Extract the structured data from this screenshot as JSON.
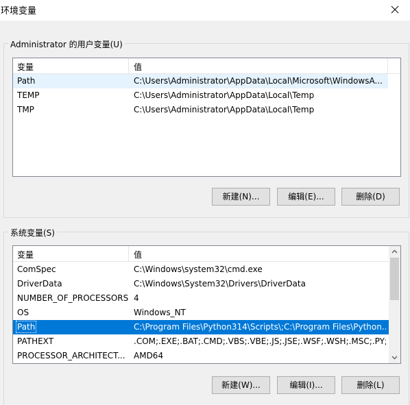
{
  "window": {
    "title": "环境变量"
  },
  "user_group": {
    "label": "Administrator 的用户变量(U)",
    "columns": [
      "变量",
      "值"
    ],
    "rows": [
      {
        "name": "Path",
        "value": "C:\\Users\\Administrator\\AppData\\Local\\Microsoft\\WindowsA..."
      },
      {
        "name": "TEMP",
        "value": "C:\\Users\\Administrator\\AppData\\Local\\Temp"
      },
      {
        "name": "TMP",
        "value": "C:\\Users\\Administrator\\AppData\\Local\\Temp"
      }
    ],
    "buttons": {
      "new": "新建(N)...",
      "edit": "编辑(E)...",
      "delete": "删除(D)"
    }
  },
  "system_group": {
    "label": "系统变量(S)",
    "columns": [
      "变量",
      "值"
    ],
    "rows": [
      {
        "name": "ComSpec",
        "value": "C:\\Windows\\system32\\cmd.exe"
      },
      {
        "name": "DriverData",
        "value": "C:\\Windows\\System32\\Drivers\\DriverData"
      },
      {
        "name": "NUMBER_OF_PROCESSORS",
        "value": "4"
      },
      {
        "name": "OS",
        "value": "Windows_NT"
      },
      {
        "name": "Path",
        "value": "C:\\Program Files\\Python314\\Scripts\\;C:\\Program Files\\Python..."
      },
      {
        "name": "PATHEXT",
        "value": ".COM;.EXE;.BAT;.CMD;.VBS;.VBE;.JS;.JSE;.WSF;.WSH;.MSC;.PY;.P..."
      },
      {
        "name": "PROCESSOR_ARCHITECT...",
        "value": "AMD64"
      }
    ],
    "buttons": {
      "new": "新建(W)...",
      "edit": "编辑(I)...",
      "delete": "删除(L)"
    }
  },
  "colors": {
    "selection": "#0078d7",
    "hover": "#e5f3ff",
    "button_bg": "#e1e1e1"
  },
  "icons": {
    "close": "close-icon",
    "scroll_up": "chevron-up-icon",
    "scroll_down": "chevron-down-icon"
  }
}
